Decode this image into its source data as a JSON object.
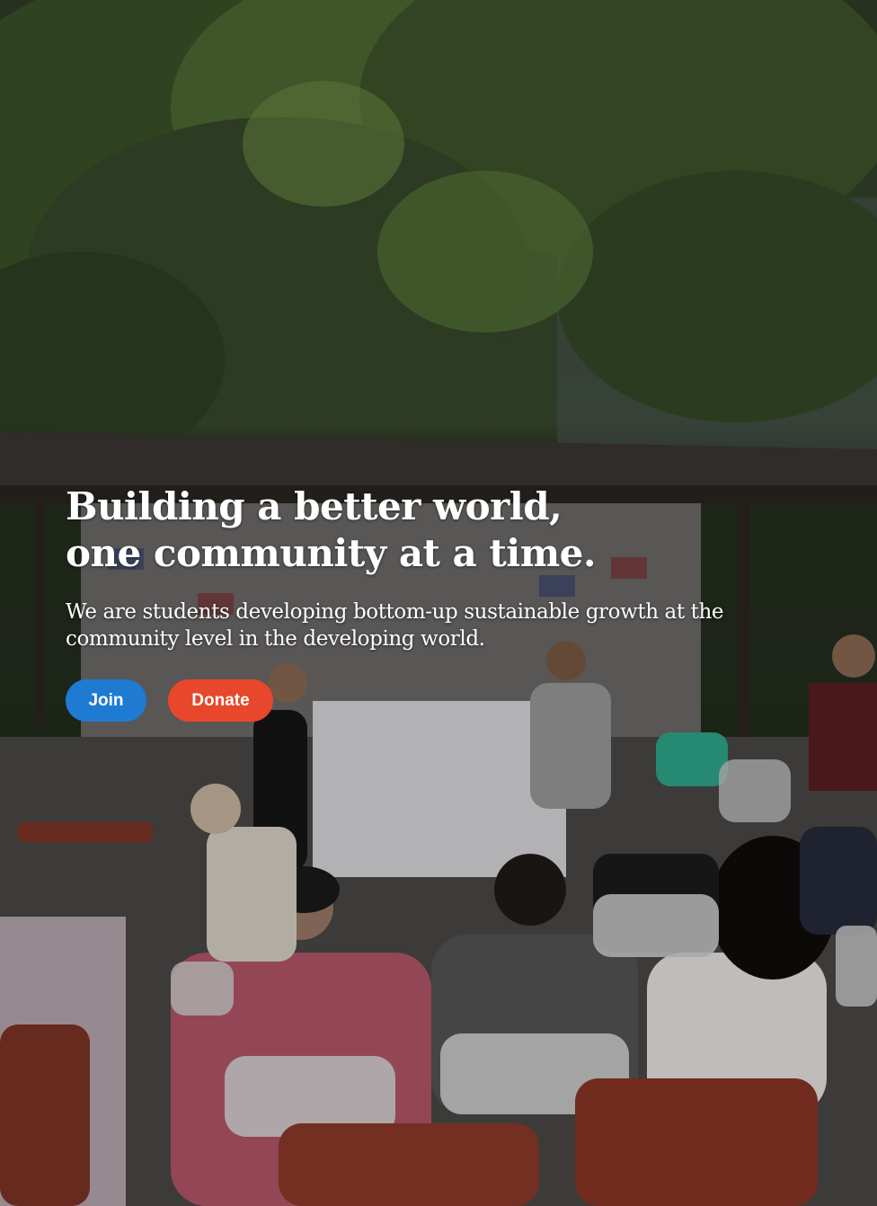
{
  "hero": {
    "headline_line1": "Building a better world,",
    "headline_line2": "one community at a time.",
    "subtitle": "We are students developing bottom-up sustainable growth at the community level in the developing world.",
    "background_image": "community-meeting-photo"
  },
  "actions": {
    "join_label": "Join",
    "donate_label": "Donate"
  },
  "colors": {
    "join": "#1e7bd1",
    "donate": "#e8472b",
    "text": "#ffffff"
  }
}
